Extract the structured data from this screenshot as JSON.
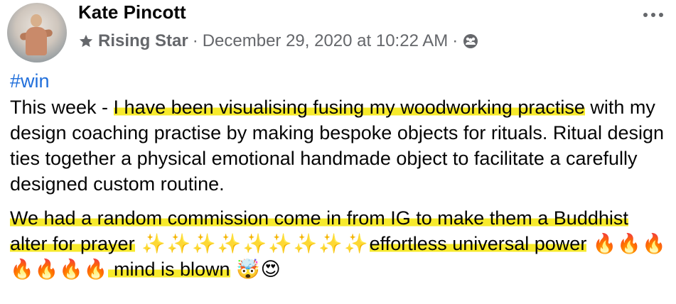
{
  "author": {
    "name": "Kate Pincott",
    "badge_icon": "star-badge-icon",
    "badge": "Rising Star",
    "separator": "·",
    "timestamp": "December 29, 2020 at 10:22 AM",
    "audience_icon": "group-audience-icon"
  },
  "post": {
    "hashtag": "#win",
    "p1_before": "This week - ",
    "p1_highlight": "I have been visualising fusing my woodworking practise",
    "p1_after": " with my design coaching practise by making bespoke objects for rituals. Ritual design ties together a physical emotional handmade object to facilitate a carefully designed custom routine.",
    "p2_highlight_a": "We had a random commission come in from IG  to make them a Buddhist alter for prayer",
    "p2_sparkles": " ✨✨✨✨✨✨✨✨✨",
    "p2_highlight_b": "effortless universal power",
    "p2_fire": " 🔥🔥🔥🔥🔥🔥🔥",
    "p2_highlight_c": " mind is blown",
    "p2_end_emoji": " 🤯😍"
  },
  "colors": {
    "highlight": "#f7ea2c",
    "hashtag": "#216fdb",
    "meta_text": "#65676b"
  }
}
